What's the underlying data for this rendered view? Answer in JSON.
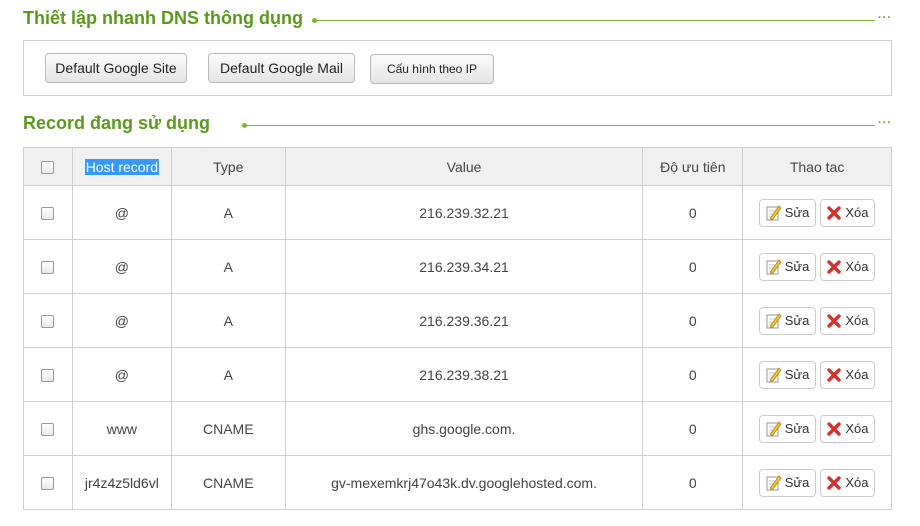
{
  "quick_dns": {
    "title": "Thiết lập nhanh DNS thông dụng",
    "buttons": [
      {
        "label": "Default Google Site"
      },
      {
        "label": "Default Google Mail"
      },
      {
        "label": "Cấu hình theo IP"
      }
    ]
  },
  "records": {
    "title": "Record đang sử dụng",
    "headers": {
      "host": "Host record",
      "type": "Type",
      "value": "Value",
      "priority": "Độ ưu tiên",
      "actions": "Thao tac"
    },
    "edit_label": "Sửa",
    "delete_label": "Xóa",
    "rows": [
      {
        "host": "@",
        "type": "A",
        "value": "216.239.32.21",
        "priority": "0"
      },
      {
        "host": "@",
        "type": "A",
        "value": "216.239.34.21",
        "priority": "0"
      },
      {
        "host": "@",
        "type": "A",
        "value": "216.239.36.21",
        "priority": "0"
      },
      {
        "host": "@",
        "type": "A",
        "value": "216.239.38.21",
        "priority": "0"
      },
      {
        "host": "www",
        "type": "CNAME",
        "value": "ghs.google.com.",
        "priority": "0"
      },
      {
        "host": "jr4z4z5ld6vl",
        "type": "CNAME",
        "value": "gv-mexemkrj47o43k.dv.googlehosted.com.",
        "priority": "0"
      }
    ]
  },
  "icons": {
    "edit": "edit-pencil-icon",
    "delete": "red-x-icon"
  },
  "colors": {
    "accent": "#5a9a1b",
    "header_bg": "#f0f0f0",
    "border": "#cfcfcf",
    "selection": "#3399ff"
  }
}
